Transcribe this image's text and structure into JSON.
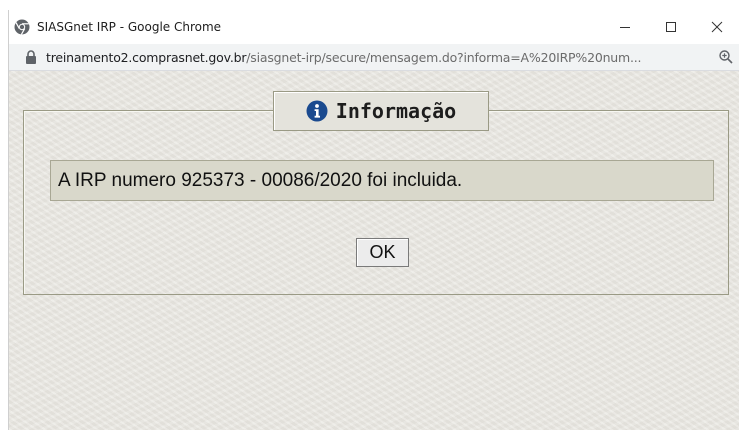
{
  "window": {
    "title": "SIASGnet IRP - Google Chrome",
    "controls": {
      "minimize_icon": "minimize-icon",
      "maximize_icon": "maximize-icon",
      "close_icon": "close-icon"
    }
  },
  "address_bar": {
    "host": "treinamento2.comprasnet.gov.br",
    "path": "/siasgnet-irp/secure/mensagem.do?informa=A%20IRP%20num...",
    "lock_icon": "lock-icon",
    "zoom_icon": "zoom-icon"
  },
  "dialog": {
    "legend_icon": "info-icon",
    "legend_title": "Informação",
    "message": "A IRP numero 925373 - 00086/2020 foi incluida.",
    "ok_label": "OK"
  },
  "colors": {
    "page_background": "#e9e7e1",
    "message_background": "#d9d8cb",
    "info_icon": "#1a4a8f"
  }
}
